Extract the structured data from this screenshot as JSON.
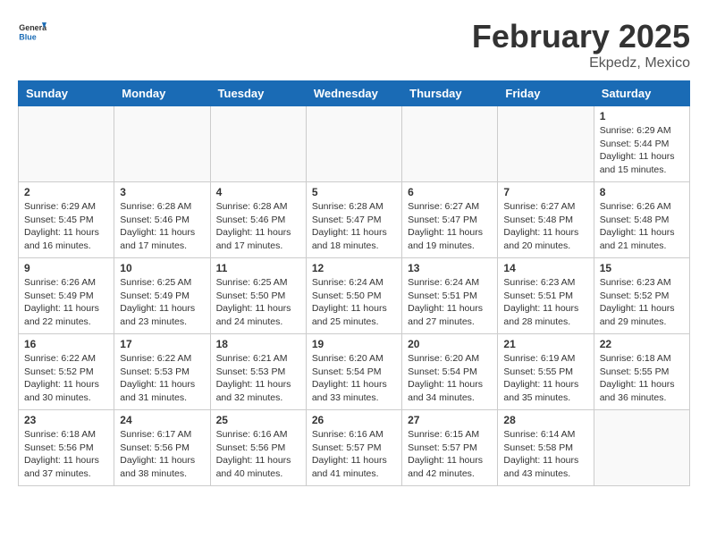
{
  "header": {
    "logo_general": "General",
    "logo_blue": "Blue",
    "month_year": "February 2025",
    "location": "Ekpedz, Mexico"
  },
  "weekdays": [
    "Sunday",
    "Monday",
    "Tuesday",
    "Wednesday",
    "Thursday",
    "Friday",
    "Saturday"
  ],
  "weeks": [
    [
      {
        "day": "",
        "info": ""
      },
      {
        "day": "",
        "info": ""
      },
      {
        "day": "",
        "info": ""
      },
      {
        "day": "",
        "info": ""
      },
      {
        "day": "",
        "info": ""
      },
      {
        "day": "",
        "info": ""
      },
      {
        "day": "1",
        "info": "Sunrise: 6:29 AM\nSunset: 5:44 PM\nDaylight: 11 hours and 15 minutes."
      }
    ],
    [
      {
        "day": "2",
        "info": "Sunrise: 6:29 AM\nSunset: 5:45 PM\nDaylight: 11 hours and 16 minutes."
      },
      {
        "day": "3",
        "info": "Sunrise: 6:28 AM\nSunset: 5:46 PM\nDaylight: 11 hours and 17 minutes."
      },
      {
        "day": "4",
        "info": "Sunrise: 6:28 AM\nSunset: 5:46 PM\nDaylight: 11 hours and 17 minutes."
      },
      {
        "day": "5",
        "info": "Sunrise: 6:28 AM\nSunset: 5:47 PM\nDaylight: 11 hours and 18 minutes."
      },
      {
        "day": "6",
        "info": "Sunrise: 6:27 AM\nSunset: 5:47 PM\nDaylight: 11 hours and 19 minutes."
      },
      {
        "day": "7",
        "info": "Sunrise: 6:27 AM\nSunset: 5:48 PM\nDaylight: 11 hours and 20 minutes."
      },
      {
        "day": "8",
        "info": "Sunrise: 6:26 AM\nSunset: 5:48 PM\nDaylight: 11 hours and 21 minutes."
      }
    ],
    [
      {
        "day": "9",
        "info": "Sunrise: 6:26 AM\nSunset: 5:49 PM\nDaylight: 11 hours and 22 minutes."
      },
      {
        "day": "10",
        "info": "Sunrise: 6:25 AM\nSunset: 5:49 PM\nDaylight: 11 hours and 23 minutes."
      },
      {
        "day": "11",
        "info": "Sunrise: 6:25 AM\nSunset: 5:50 PM\nDaylight: 11 hours and 24 minutes."
      },
      {
        "day": "12",
        "info": "Sunrise: 6:24 AM\nSunset: 5:50 PM\nDaylight: 11 hours and 25 minutes."
      },
      {
        "day": "13",
        "info": "Sunrise: 6:24 AM\nSunset: 5:51 PM\nDaylight: 11 hours and 27 minutes."
      },
      {
        "day": "14",
        "info": "Sunrise: 6:23 AM\nSunset: 5:51 PM\nDaylight: 11 hours and 28 minutes."
      },
      {
        "day": "15",
        "info": "Sunrise: 6:23 AM\nSunset: 5:52 PM\nDaylight: 11 hours and 29 minutes."
      }
    ],
    [
      {
        "day": "16",
        "info": "Sunrise: 6:22 AM\nSunset: 5:52 PM\nDaylight: 11 hours and 30 minutes."
      },
      {
        "day": "17",
        "info": "Sunrise: 6:22 AM\nSunset: 5:53 PM\nDaylight: 11 hours and 31 minutes."
      },
      {
        "day": "18",
        "info": "Sunrise: 6:21 AM\nSunset: 5:53 PM\nDaylight: 11 hours and 32 minutes."
      },
      {
        "day": "19",
        "info": "Sunrise: 6:20 AM\nSunset: 5:54 PM\nDaylight: 11 hours and 33 minutes."
      },
      {
        "day": "20",
        "info": "Sunrise: 6:20 AM\nSunset: 5:54 PM\nDaylight: 11 hours and 34 minutes."
      },
      {
        "day": "21",
        "info": "Sunrise: 6:19 AM\nSunset: 5:55 PM\nDaylight: 11 hours and 35 minutes."
      },
      {
        "day": "22",
        "info": "Sunrise: 6:18 AM\nSunset: 5:55 PM\nDaylight: 11 hours and 36 minutes."
      }
    ],
    [
      {
        "day": "23",
        "info": "Sunrise: 6:18 AM\nSunset: 5:56 PM\nDaylight: 11 hours and 37 minutes."
      },
      {
        "day": "24",
        "info": "Sunrise: 6:17 AM\nSunset: 5:56 PM\nDaylight: 11 hours and 38 minutes."
      },
      {
        "day": "25",
        "info": "Sunrise: 6:16 AM\nSunset: 5:56 PM\nDaylight: 11 hours and 40 minutes."
      },
      {
        "day": "26",
        "info": "Sunrise: 6:16 AM\nSunset: 5:57 PM\nDaylight: 11 hours and 41 minutes."
      },
      {
        "day": "27",
        "info": "Sunrise: 6:15 AM\nSunset: 5:57 PM\nDaylight: 11 hours and 42 minutes."
      },
      {
        "day": "28",
        "info": "Sunrise: 6:14 AM\nSunset: 5:58 PM\nDaylight: 11 hours and 43 minutes."
      },
      {
        "day": "",
        "info": ""
      }
    ]
  ]
}
